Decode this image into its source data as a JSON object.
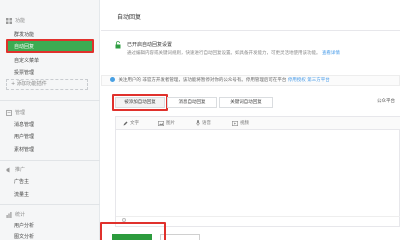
{
  "sidebar": {
    "section_function": "功能",
    "items_function": [
      "群发功能",
      "自动回复",
      "自定义菜单",
      "投票管理"
    ],
    "add_plugin": "+ 添加功能插件",
    "section_manage": "管理",
    "items_manage": [
      "消息管理",
      "用户管理",
      "素材管理"
    ],
    "section_promote": "推广",
    "items_promote": [
      "广告主",
      "流量主"
    ],
    "section_stats": "统计",
    "items_stats": [
      "用户分析",
      "图文分析"
    ]
  },
  "main": {
    "title": "自动回复",
    "switch_title": "已开启自动回复设置",
    "switch_desc": "通过编辑内容或关键词规则，快速进行自动回复设置。如具备开发能力，可更灵活地使用该功能。",
    "switch_link": "查看详情",
    "info_text": "关注用户的 非官方开发者管理，该功能将暂停对你的公众号有。停用管理后可在平台",
    "info_link": "停用授权 第三方平台",
    "tabs": [
      "被添加自动回复",
      "消息自动回复",
      "关键词自动回复"
    ],
    "right_label": "公众平台",
    "toolbar": [
      "文字",
      "图片",
      "语音",
      "视频"
    ]
  },
  "colors": {
    "accent_green": "#3dab52",
    "highlight_red": "#e0312c",
    "link_blue": "#459ae9"
  }
}
